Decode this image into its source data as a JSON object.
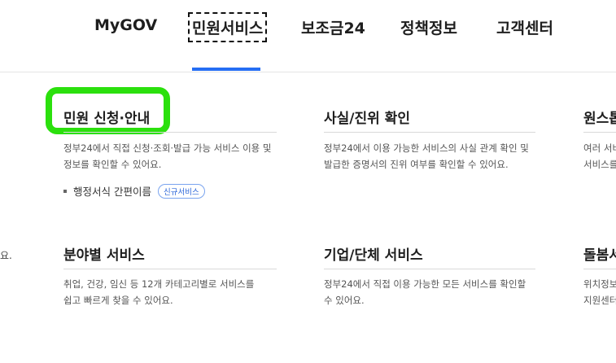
{
  "nav": {
    "items": [
      "MyGOV",
      "민원서비스",
      "보조금24",
      "정책정보",
      "고객센터"
    ]
  },
  "cards": {
    "civil_apply": {
      "title": "민원 신청·안내",
      "desc_line1": "정부24에서 직접 신청·조회·발급 가능 서비스 이용 및",
      "desc_line2": "정보를 확인할 수 있어요.",
      "sub_link": "행정서식 간편이름",
      "badge": "신규서비스"
    },
    "fact_check": {
      "title": "사실/진위 확인",
      "desc_line1": "정부24에서 이용 가능한 서비스의 사실 관계 확인 및",
      "desc_line2": "발급한 증명서의 진위 여부를 확인할 수 있어요."
    },
    "one_stop": {
      "title": "원스톱",
      "desc_line1": "여러 서비",
      "desc_line2": "서비스를"
    },
    "by_field": {
      "title": "분야별 서비스",
      "desc_line1": "취업, 건강, 임신 등 12개 카테고리별로 서비스를",
      "desc_line2": "쉽고 빠르게 찾을 수 있어요."
    },
    "corp_group": {
      "title": "기업/단체 서비스",
      "desc_line1": "정부24에서 직접 이용 가능한 모든 서비스를 확인할",
      "desc_line2": "수 있어요."
    },
    "care": {
      "title": "돌봄서",
      "desc_line1": "위치정보",
      "desc_line2": "지원센터"
    }
  },
  "left_edge_text": "요."
}
